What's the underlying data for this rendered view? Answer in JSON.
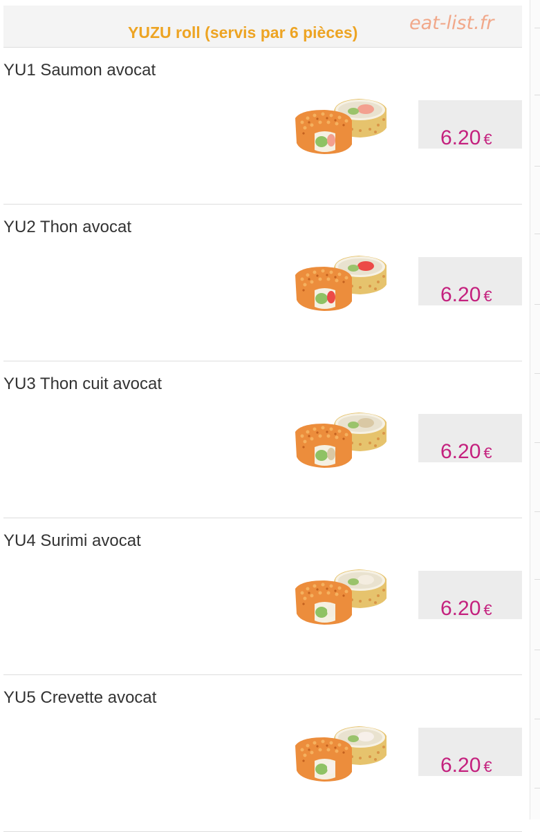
{
  "header": {
    "title": "YUZU roll (servis par 6 pièces)",
    "watermark": "eat-list.fr"
  },
  "items": [
    {
      "name": "YU1 Saumon avocat",
      "price": "6.20",
      "currency": "€",
      "filling_color": "#f3a08f"
    },
    {
      "name": "YU2 Thon avocat",
      "price": "6.20",
      "currency": "€",
      "filling_color": "#ec4a47"
    },
    {
      "name": "YU3 Thon cuit avocat",
      "price": "6.20",
      "currency": "€",
      "filling_color": "#d9c8a4"
    },
    {
      "name": "YU4 Surimi avocat",
      "price": "6.20",
      "currency": "€",
      "filling_color": "#f4ede0"
    },
    {
      "name": "YU5 Crevette avocat",
      "price": "6.20",
      "currency": "€",
      "filling_color": "#f7f0ea"
    }
  ],
  "colors": {
    "header_title": "#eda423",
    "price": "#c4217e",
    "watermark": "#f1a88a"
  },
  "icons": {
    "dish": "sushi-roll-icon"
  }
}
